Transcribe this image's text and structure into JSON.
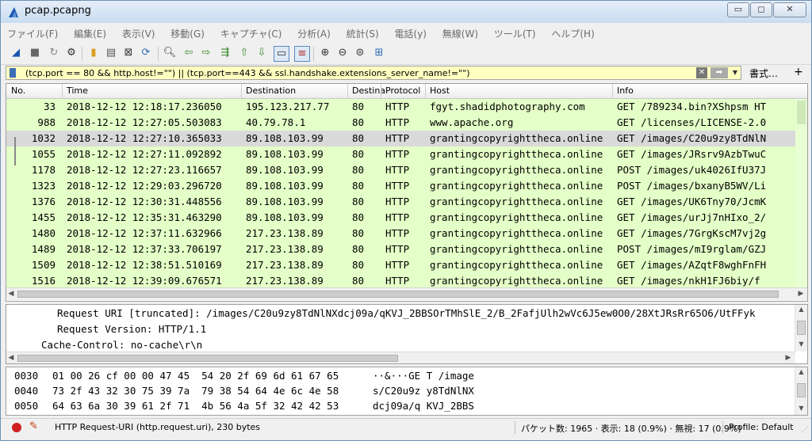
{
  "window": {
    "title": "pcap.pcapng",
    "minimize": "▭",
    "maximize": "◻",
    "close": "✕"
  },
  "menu": [
    "ファイル(F)",
    "編集(E)",
    "表示(V)",
    "移動(G)",
    "キャプチャ(C)",
    "分析(A)",
    "統計(S)",
    "電話(y)",
    "無線(W)",
    "ツール(T)",
    "ヘルプ(H)"
  ],
  "filter": {
    "value": "(tcp.port == 80 && http.host!=\"\") || (tcp.port==443 && ssl.handshake.extensions_server_name!=\"\")",
    "expression_label": "書式…",
    "add_label": "+"
  },
  "packet_list": {
    "columns": [
      "No.",
      "Time",
      "Destination",
      "Destina",
      "Protocol",
      "Host",
      "Info"
    ],
    "rows": [
      [
        "33",
        "2018-12-12 12:18:17.236050",
        "195.123.217.77",
        "80",
        "HTTP",
        "fgyt.shadidphotography.com",
        "GET /789234.bin?XShpsm HT"
      ],
      [
        "988",
        "2018-12-12 12:27:05.503083",
        "40.79.78.1",
        "80",
        "HTTP",
        "www.apache.org",
        "GET /licenses/LICENSE-2.0"
      ],
      [
        "1032",
        "2018-12-12 12:27:10.365033",
        "89.108.103.99",
        "80",
        "HTTP",
        "grantingcopyrighttheca.online",
        "GET /images/C20u9zy8TdNlN"
      ],
      [
        "1055",
        "2018-12-12 12:27:11.092892",
        "89.108.103.99",
        "80",
        "HTTP",
        "grantingcopyrighttheca.online",
        "GET /images/JRsrv9AzbTwuC"
      ],
      [
        "1178",
        "2018-12-12 12:27:23.116657",
        "89.108.103.99",
        "80",
        "HTTP",
        "grantingcopyrighttheca.online",
        "POST /images/uk4026IfU37J"
      ],
      [
        "1323",
        "2018-12-12 12:29:03.296720",
        "89.108.103.99",
        "80",
        "HTTP",
        "grantingcopyrighttheca.online",
        "POST /images/bxanyB5WV/Li"
      ],
      [
        "1376",
        "2018-12-12 12:30:31.448556",
        "89.108.103.99",
        "80",
        "HTTP",
        "grantingcopyrighttheca.online",
        "GET /images/UK6Tny70/JcmK"
      ],
      [
        "1455",
        "2018-12-12 12:35:31.463290",
        "89.108.103.99",
        "80",
        "HTTP",
        "grantingcopyrighttheca.online",
        "GET /images/urJj7nHIxo_2/"
      ],
      [
        "1480",
        "2018-12-12 12:37:11.632966",
        "217.23.138.89",
        "80",
        "HTTP",
        "grantingcopyrighttheca.online",
        "GET /images/7GrgKscM7vj2g"
      ],
      [
        "1489",
        "2018-12-12 12:37:33.706197",
        "217.23.138.89",
        "80",
        "HTTP",
        "grantingcopyrighttheca.online",
        "POST /images/mI9rglam/GZJ"
      ],
      [
        "1509",
        "2018-12-12 12:38:51.510169",
        "217.23.138.89",
        "80",
        "HTTP",
        "grantingcopyrighttheca.online",
        "GET /images/AZqtF8wghFnFH"
      ],
      [
        "1516",
        "2018-12-12 12:39:09.676571",
        "217.23.138.89",
        "80",
        "HTTP",
        "grantingcopyrighttheca.online",
        "GET /images/nkH1FJ6biy/f"
      ]
    ],
    "selected_row": 2
  },
  "details": [
    "Request URI [truncated]: /images/C20u9zy8TdNlNXdcj09a/qKVJ_2BBSOrTMhSlE_2/B_2FafjUlh2wVc6J5ew0O0/28XtJRsRr65O6/UtFFyk",
    "Request Version: HTTP/1.1",
    "Cache-Control: no-cache\\r\\n"
  ],
  "hex": [
    {
      "offset": "0030",
      "bytes": "01 00 26 cf 00 00 47 45  54 20 2f 69 6d 61 67 65",
      "ascii": "··&···GE T /image"
    },
    {
      "offset": "0040",
      "bytes": "73 2f 43 32 30 75 39 7a  79 38 54 64 4e 6c 4e 58",
      "ascii": "s/C20u9z y8TdNlNX"
    },
    {
      "offset": "0050",
      "bytes": "64 63 6a 30 39 61 2f 71  4b 56 4a 5f 32 42 42 53",
      "ascii": "dcj09a/q KVJ_2BBS"
    }
  ],
  "status": {
    "message": "HTTP Request-URI (http.request.uri), 230 bytes",
    "packets": "パケット数: 1965 · 表示: 18 (0.9%) · 無視: 17 (0.9%)",
    "profile": "Profile: Default"
  }
}
